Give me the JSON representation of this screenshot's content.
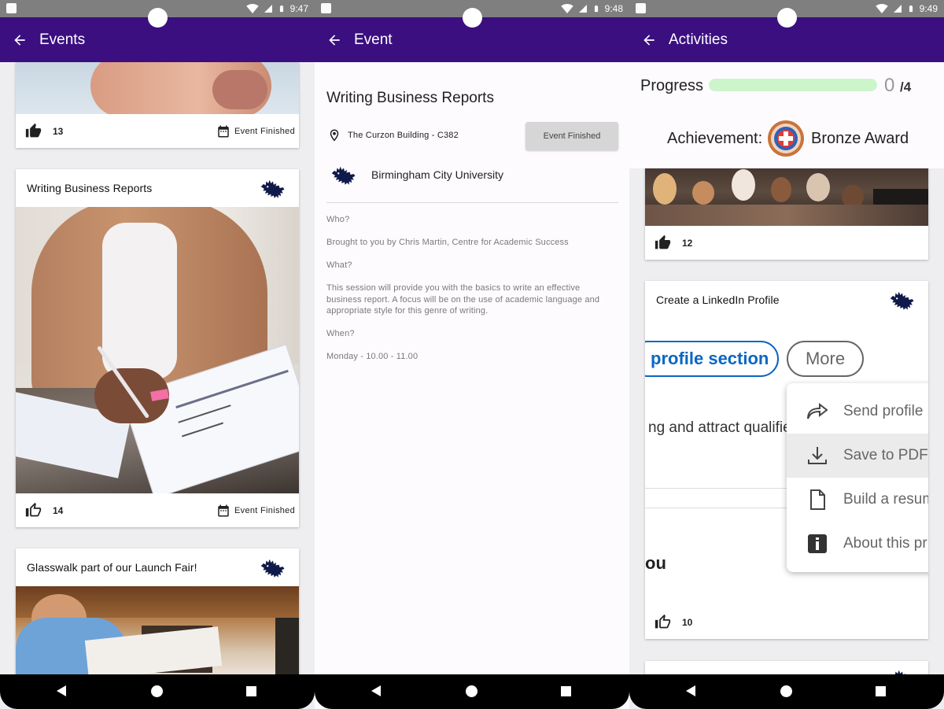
{
  "screens": [
    {
      "status_time": "9:47",
      "title": "Events",
      "cards": [
        {
          "likes": "13",
          "status": "Event Finished"
        },
        {
          "title": "Writing Business Reports",
          "likes": "14",
          "status": "Event Finished"
        },
        {
          "title": "Glasswalk part of our Launch Fair!"
        }
      ]
    },
    {
      "status_time": "9:48",
      "title": "Event",
      "event": {
        "title": "Writing Business Reports",
        "location": "The Curzon Building - C382",
        "status_button": "Event Finished",
        "organiser": "Birmingham City University",
        "who_label": "Who?",
        "who": "Brought to you by Chris Martin, Centre for Academic Success",
        "what_label": "What?",
        "what": "This session will provide you with the basics to write an effective business report. A focus will be on the use of academic language and appropriate style for this genre of writing.",
        "when_label": "When?",
        "when": "Monday - 10.00 - 11.00"
      }
    },
    {
      "status_time": "9:49",
      "title": "Activities",
      "progress": {
        "label": "Progress",
        "count": "0",
        "total": "/4",
        "fraction": 0
      },
      "achievement": {
        "label": "Achievement:",
        "name": "Bronze Award"
      },
      "cards": [
        {
          "likes": "12"
        },
        {
          "title": "Create a LinkedIn Profile",
          "likes": "10",
          "image": {
            "pill_primary": "profile section",
            "pill_more": "More",
            "text_partial": "ng and attract qualifie",
            "text_bold": "ou",
            "menu": [
              "Send profile",
              "Save to PDF",
              "Build a resum",
              "About this pr"
            ]
          }
        }
      ]
    }
  ]
}
